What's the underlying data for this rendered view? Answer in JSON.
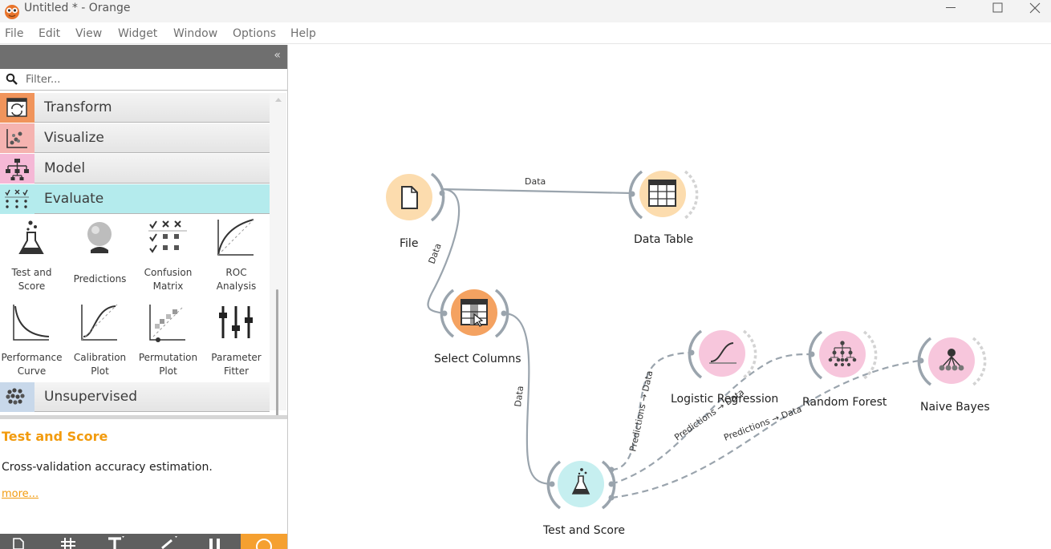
{
  "window": {
    "title": "Untitled * - Orange",
    "controls": [
      "minimize",
      "maximize",
      "close"
    ]
  },
  "menu": [
    "File",
    "Edit",
    "View",
    "Widget",
    "Window",
    "Options",
    "Help"
  ],
  "toolbox": {
    "collapse_glyph": "«",
    "filter_placeholder": "Filter...",
    "categories": [
      {
        "label": "Transform",
        "color": "#f0945b"
      },
      {
        "label": "Visualize",
        "color": "#f5b3b0"
      },
      {
        "label": "Model",
        "color": "#f5b8d6"
      },
      {
        "label": "Evaluate",
        "color": "#b4ebed",
        "expanded": true
      },
      {
        "label": "Unsupervised",
        "color": "#c8d8ea"
      }
    ],
    "evaluate_widgets": [
      {
        "label_lines": [
          "Test and",
          "Score"
        ],
        "icon": "flask-icon"
      },
      {
        "label_lines": [
          "Predictions"
        ],
        "icon": "crystal-ball-icon"
      },
      {
        "label_lines": [
          "Confusion",
          "Matrix"
        ],
        "icon": "confusion-matrix-icon"
      },
      {
        "label_lines": [
          "ROC",
          "Analysis"
        ],
        "icon": "roc-curve-icon"
      },
      {
        "label_lines": [
          "Performance",
          "Curve"
        ],
        "icon": "performance-curve-icon"
      },
      {
        "label_lines": [
          "Calibration",
          "Plot"
        ],
        "icon": "calibration-plot-icon"
      },
      {
        "label_lines": [
          "Permutation",
          "Plot"
        ],
        "icon": "permutation-plot-icon"
      },
      {
        "label_lines": [
          "Parameter",
          "Fitter"
        ],
        "icon": "parameter-sliders-icon"
      }
    ],
    "description": {
      "title": "Test and Score",
      "text": "Cross-validation accuracy estimation.",
      "more": "more..."
    }
  },
  "workflow": {
    "nodes": [
      {
        "id": "file",
        "label": "File",
        "color": "#fcdcae"
      },
      {
        "id": "data-table",
        "label": "Data Table",
        "color": "#fcdcae"
      },
      {
        "id": "select-columns",
        "label": "Select Columns",
        "color": "#f4a261"
      },
      {
        "id": "logistic-regression",
        "label": "Logistic Regression",
        "color": "#f7c6dc"
      },
      {
        "id": "random-forest",
        "label": "Random Forest",
        "color": "#f7c6dc"
      },
      {
        "id": "naive-bayes",
        "label": "Naive Bayes",
        "color": "#f7c6dc"
      },
      {
        "id": "test-and-score",
        "label": "Test and Score",
        "color": "#c6eff0"
      }
    ],
    "links": [
      {
        "from": "File",
        "to": "Data Table",
        "label": "Data",
        "style": "solid"
      },
      {
        "from": "File",
        "to": "Select Columns",
        "label": "Data",
        "style": "solid"
      },
      {
        "from": "Select Columns",
        "to": "Test and Score",
        "label": "Data",
        "style": "solid"
      },
      {
        "from": "Test and Score",
        "to": "Logistic Regression",
        "label": "Predictions → Data",
        "style": "dashed"
      },
      {
        "from": "Test and Score",
        "to": "Random Forest",
        "label": "Predictions → Data",
        "style": "dashed"
      },
      {
        "from": "Test and Score",
        "to": "Naive Bayes",
        "label": "Predictions → Data",
        "style": "dashed"
      }
    ]
  }
}
